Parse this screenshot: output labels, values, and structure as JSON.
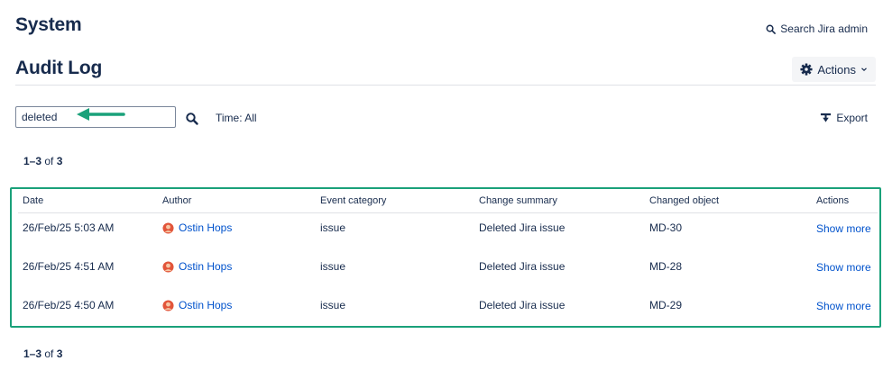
{
  "header": {
    "title": "System",
    "search_admin_label": "Search Jira admin"
  },
  "page": {
    "title": "Audit Log",
    "actions_label": "Actions"
  },
  "filter": {
    "search_value": "deleted",
    "time_label": "Time: All",
    "export_label": "Export"
  },
  "pagination": {
    "range": "1–3",
    "of_label": "of",
    "total": "3"
  },
  "table": {
    "columns": {
      "date": "Date",
      "author": "Author",
      "category": "Event category",
      "summary": "Change summary",
      "object": "Changed object",
      "actions": "Actions"
    },
    "rows": [
      {
        "date": "26/Feb/25 5:03 AM",
        "author": "Ostin Hops",
        "category": "issue",
        "summary": "Deleted Jira issue",
        "object": "MD-30",
        "action": "Show more"
      },
      {
        "date": "26/Feb/25 4:51 AM",
        "author": "Ostin Hops",
        "category": "issue",
        "summary": "Deleted Jira issue",
        "object": "MD-28",
        "action": "Show more"
      },
      {
        "date": "26/Feb/25 4:50 AM",
        "author": "Ostin Hops",
        "category": "issue",
        "summary": "Deleted Jira issue",
        "object": "MD-29",
        "action": "Show more"
      }
    ]
  },
  "colors": {
    "annotation": "#1aa17a",
    "link": "#0052cc",
    "text": "#172b4d"
  },
  "icons": [
    "search-icon",
    "gear-icon",
    "chevron-down-icon",
    "export-icon",
    "avatar-icon",
    "annotation-arrow-icon"
  ]
}
